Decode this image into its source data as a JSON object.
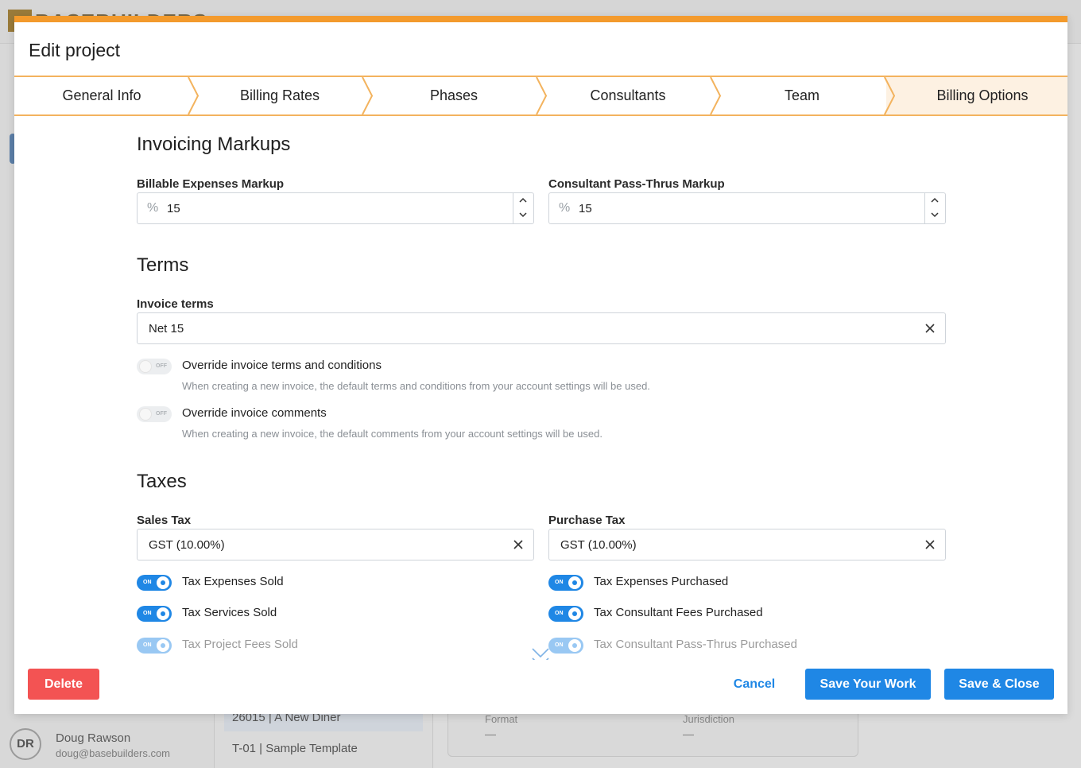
{
  "background": {
    "logo": "BASEBUILDERS",
    "user": {
      "initials": "DR",
      "name": "Doug Rawson",
      "email": "doug@basebuilders.com"
    },
    "projects": [
      "26015 | A New Diner",
      "T-01 | Sample Template"
    ],
    "card": {
      "format_label": "Format",
      "format_value": "—",
      "jurisdiction_label": "Jurisdiction",
      "jurisdiction_value": "—"
    }
  },
  "modal": {
    "title": "Edit project",
    "tabs": [
      {
        "label": "General Info",
        "active": false
      },
      {
        "label": "Billing Rates",
        "active": false
      },
      {
        "label": "Phases",
        "active": false
      },
      {
        "label": "Consultants",
        "active": false
      },
      {
        "label": "Team",
        "active": false
      },
      {
        "label": "Billing Options",
        "active": true
      }
    ],
    "invoicing_markups": {
      "title": "Invoicing Markups",
      "billable_expenses": {
        "label": "Billable Expenses Markup",
        "prefix": "%",
        "value": "15"
      },
      "consultant_passthru": {
        "label": "Consultant Pass-Thrus Markup",
        "prefix": "%",
        "value": "15"
      }
    },
    "terms": {
      "title": "Terms",
      "invoice_terms_label": "Invoice terms",
      "invoice_terms_value": "Net 15",
      "override_terms": {
        "label": "Override invoice terms and conditions",
        "description": "When creating a new invoice, the default terms and conditions from your account settings will be used.",
        "state": "OFF"
      },
      "override_comments": {
        "label": "Override invoice comments",
        "description": "When creating a new invoice, the default comments from your account settings will be used.",
        "state": "OFF"
      }
    },
    "taxes": {
      "title": "Taxes",
      "sales_tax_label": "Sales Tax",
      "sales_tax_value": "GST (10.00%)",
      "purchase_tax_label": "Purchase Tax",
      "purchase_tax_value": "GST (10.00%)",
      "sales_toggles": [
        {
          "label": "Tax Expenses Sold",
          "state": "ON"
        },
        {
          "label": "Tax Services Sold",
          "state": "ON"
        },
        {
          "label": "Tax Project Fees Sold",
          "state": "ON"
        }
      ],
      "purchase_toggles": [
        {
          "label": "Tax Expenses Purchased",
          "state": "ON"
        },
        {
          "label": "Tax Consultant Fees Purchased",
          "state": "ON"
        },
        {
          "label": "Tax Consultant Pass-Thrus Purchased",
          "state": "ON"
        }
      ]
    },
    "footer": {
      "delete": "Delete",
      "cancel": "Cancel",
      "save": "Save Your Work",
      "save_close": "Save & Close"
    }
  },
  "colors": {
    "accent": "#f39a2c",
    "primary": "#1f87e5",
    "danger": "#f35353"
  }
}
